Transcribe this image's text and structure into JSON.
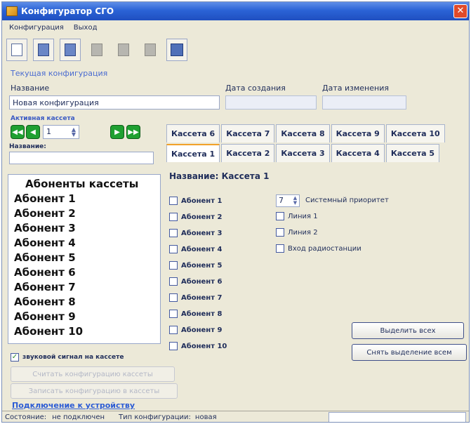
{
  "window": {
    "title": "Конфигуратор СГО",
    "close_symbol": "✕"
  },
  "menu": {
    "items": [
      "Конфигурация",
      "Выход"
    ]
  },
  "toolbar": {
    "icons": [
      "new-document-icon",
      "open-icon",
      "save-icon",
      "save-as-icon",
      "export-icon",
      "import-icon",
      "write-device-icon"
    ]
  },
  "config": {
    "section_title": "Текущая конфигурация",
    "name_label": "Название",
    "name_value": "Новая конфигурация",
    "created_label": "Дата создания",
    "created_value": "",
    "modified_label": "Дата изменения",
    "modified_value": ""
  },
  "cassette_nav": {
    "active_label": "Активная кассета",
    "number": "1",
    "name_label": "Название:",
    "name_value": ""
  },
  "tabs": {
    "row1": [
      "Кассета 6",
      "Кассета 7",
      "Кассета 8",
      "Кассета 9",
      "Кассета 10"
    ],
    "row2": [
      "Кассета 1",
      "Кассета 2",
      "Кассета 3",
      "Кассета 4",
      "Кассета 5"
    ],
    "active": "Кассета 1"
  },
  "subscribers": {
    "header": "Абоненты кассеты",
    "items": [
      "Абонент 1",
      "Абонент 2",
      "Абонент 3",
      "Абонент 4",
      "Абонент 5",
      "Абонент 6",
      "Абонент 7",
      "Абонент 8",
      "Абонент 9",
      "Абонент 10"
    ]
  },
  "sound_signal": {
    "label": "звуковой сигнал на кассете",
    "checked": true,
    "check_mark": "✓"
  },
  "disabled_buttons": {
    "read": "Считать конфигурацию кассеты",
    "write": "Записать конфигурацию в кассеты"
  },
  "connect_link": "Подключение к устройству",
  "cassette_panel": {
    "title": "Название: Кассета 1",
    "checkboxes": [
      "Абонент 1",
      "Абонент 2",
      "Абонент 3",
      "Абонент 4",
      "Абонент 5",
      "Абонент 6",
      "Абонент 7",
      "Абонент 8",
      "Абонент 9",
      "Абонент 10"
    ],
    "priority_value": "7",
    "priority_label": "Системный приоритет",
    "line1": "Линия 1",
    "line2": "Линия 2",
    "radio_input": "Вход радиостанции",
    "select_all": "Выделить всех",
    "deselect_all": "Снять выделение всем"
  },
  "status": {
    "state_label": "Состояние:",
    "state_value": "не подключен",
    "type_label": "Тип конфигурации:",
    "type_value": "новая"
  },
  "colors": {
    "accent": "#2b63d6",
    "nav_green": "#1fa031",
    "tab_active": "#f2a22a"
  }
}
